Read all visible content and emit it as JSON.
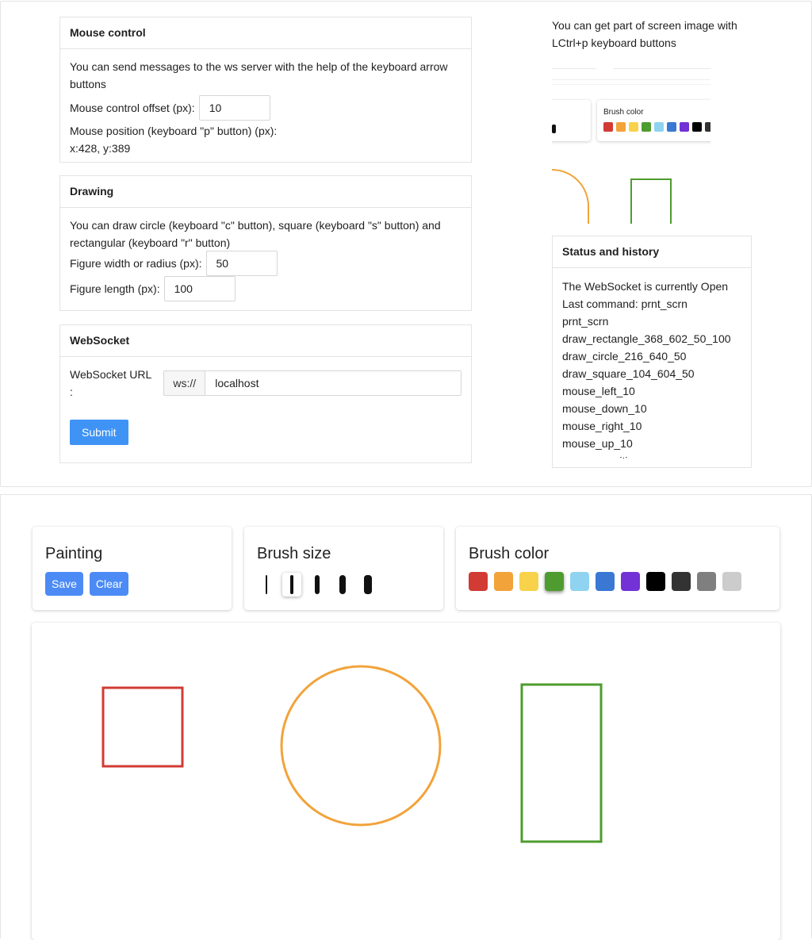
{
  "mouse_control": {
    "title": "Mouse control",
    "description": "You can send messages to the ws server with the help of the keyboard arrow buttons",
    "offset_label": "Mouse control offset (px):",
    "offset_value": "10",
    "position_label": "Mouse position (keyboard \"p\" button) (px):",
    "position_value": "x:428, y:389"
  },
  "drawing": {
    "title": "Drawing",
    "description": "You can draw circle (keyboard \"c\" button), square (keyboard \"s\" button) and rectangular (keyboard \"r\" button)",
    "width_label": "Figure width or radius (px):",
    "width_value": "50",
    "length_label": "Figure length (px):",
    "length_value": "100"
  },
  "websocket": {
    "title": "WebSocket",
    "url_label": "WebSocket URL :",
    "prefix": "ws://",
    "url_value": "localhost",
    "submit_label": "Submit"
  },
  "screenshot_hint": "You can get part of screen image with LCtrl+p keyboard buttons",
  "preview": {
    "brush_color_label": "Brush color"
  },
  "status": {
    "title": "Status and history",
    "lines": [
      "The WebSocket is currently Open",
      "Last command: prnt_scrn",
      "prnt_scrn",
      "draw_rectangle_368_602_50_100",
      "draw_circle_216_640_50",
      "draw_square_104_604_50",
      "mouse_left_10",
      "mouse_down_10",
      "mouse_right_10",
      "mouse_up_10",
      "mouse_position"
    ]
  },
  "painting": {
    "title": "Painting",
    "save_label": "Save",
    "clear_label": "Clear"
  },
  "brush_size": {
    "title": "Brush size",
    "sizes": [
      "size-1",
      "size-2",
      "size-3",
      "size-4",
      "size-5"
    ],
    "selected": 1
  },
  "brush_color": {
    "title": "Brush color",
    "colors": [
      "#d13b34",
      "#f2a33a",
      "#f8d24a",
      "#4e9c2f",
      "#8fd3f0",
      "#3a78d4",
      "#7232d6",
      "#000000",
      "#333333",
      "#7f7f7f",
      "#cccccc"
    ],
    "selected": 3
  },
  "canvas_colors": {
    "square": "#d13b34",
    "circle": "#f2a33a",
    "rectangle": "#4e9c2f"
  }
}
